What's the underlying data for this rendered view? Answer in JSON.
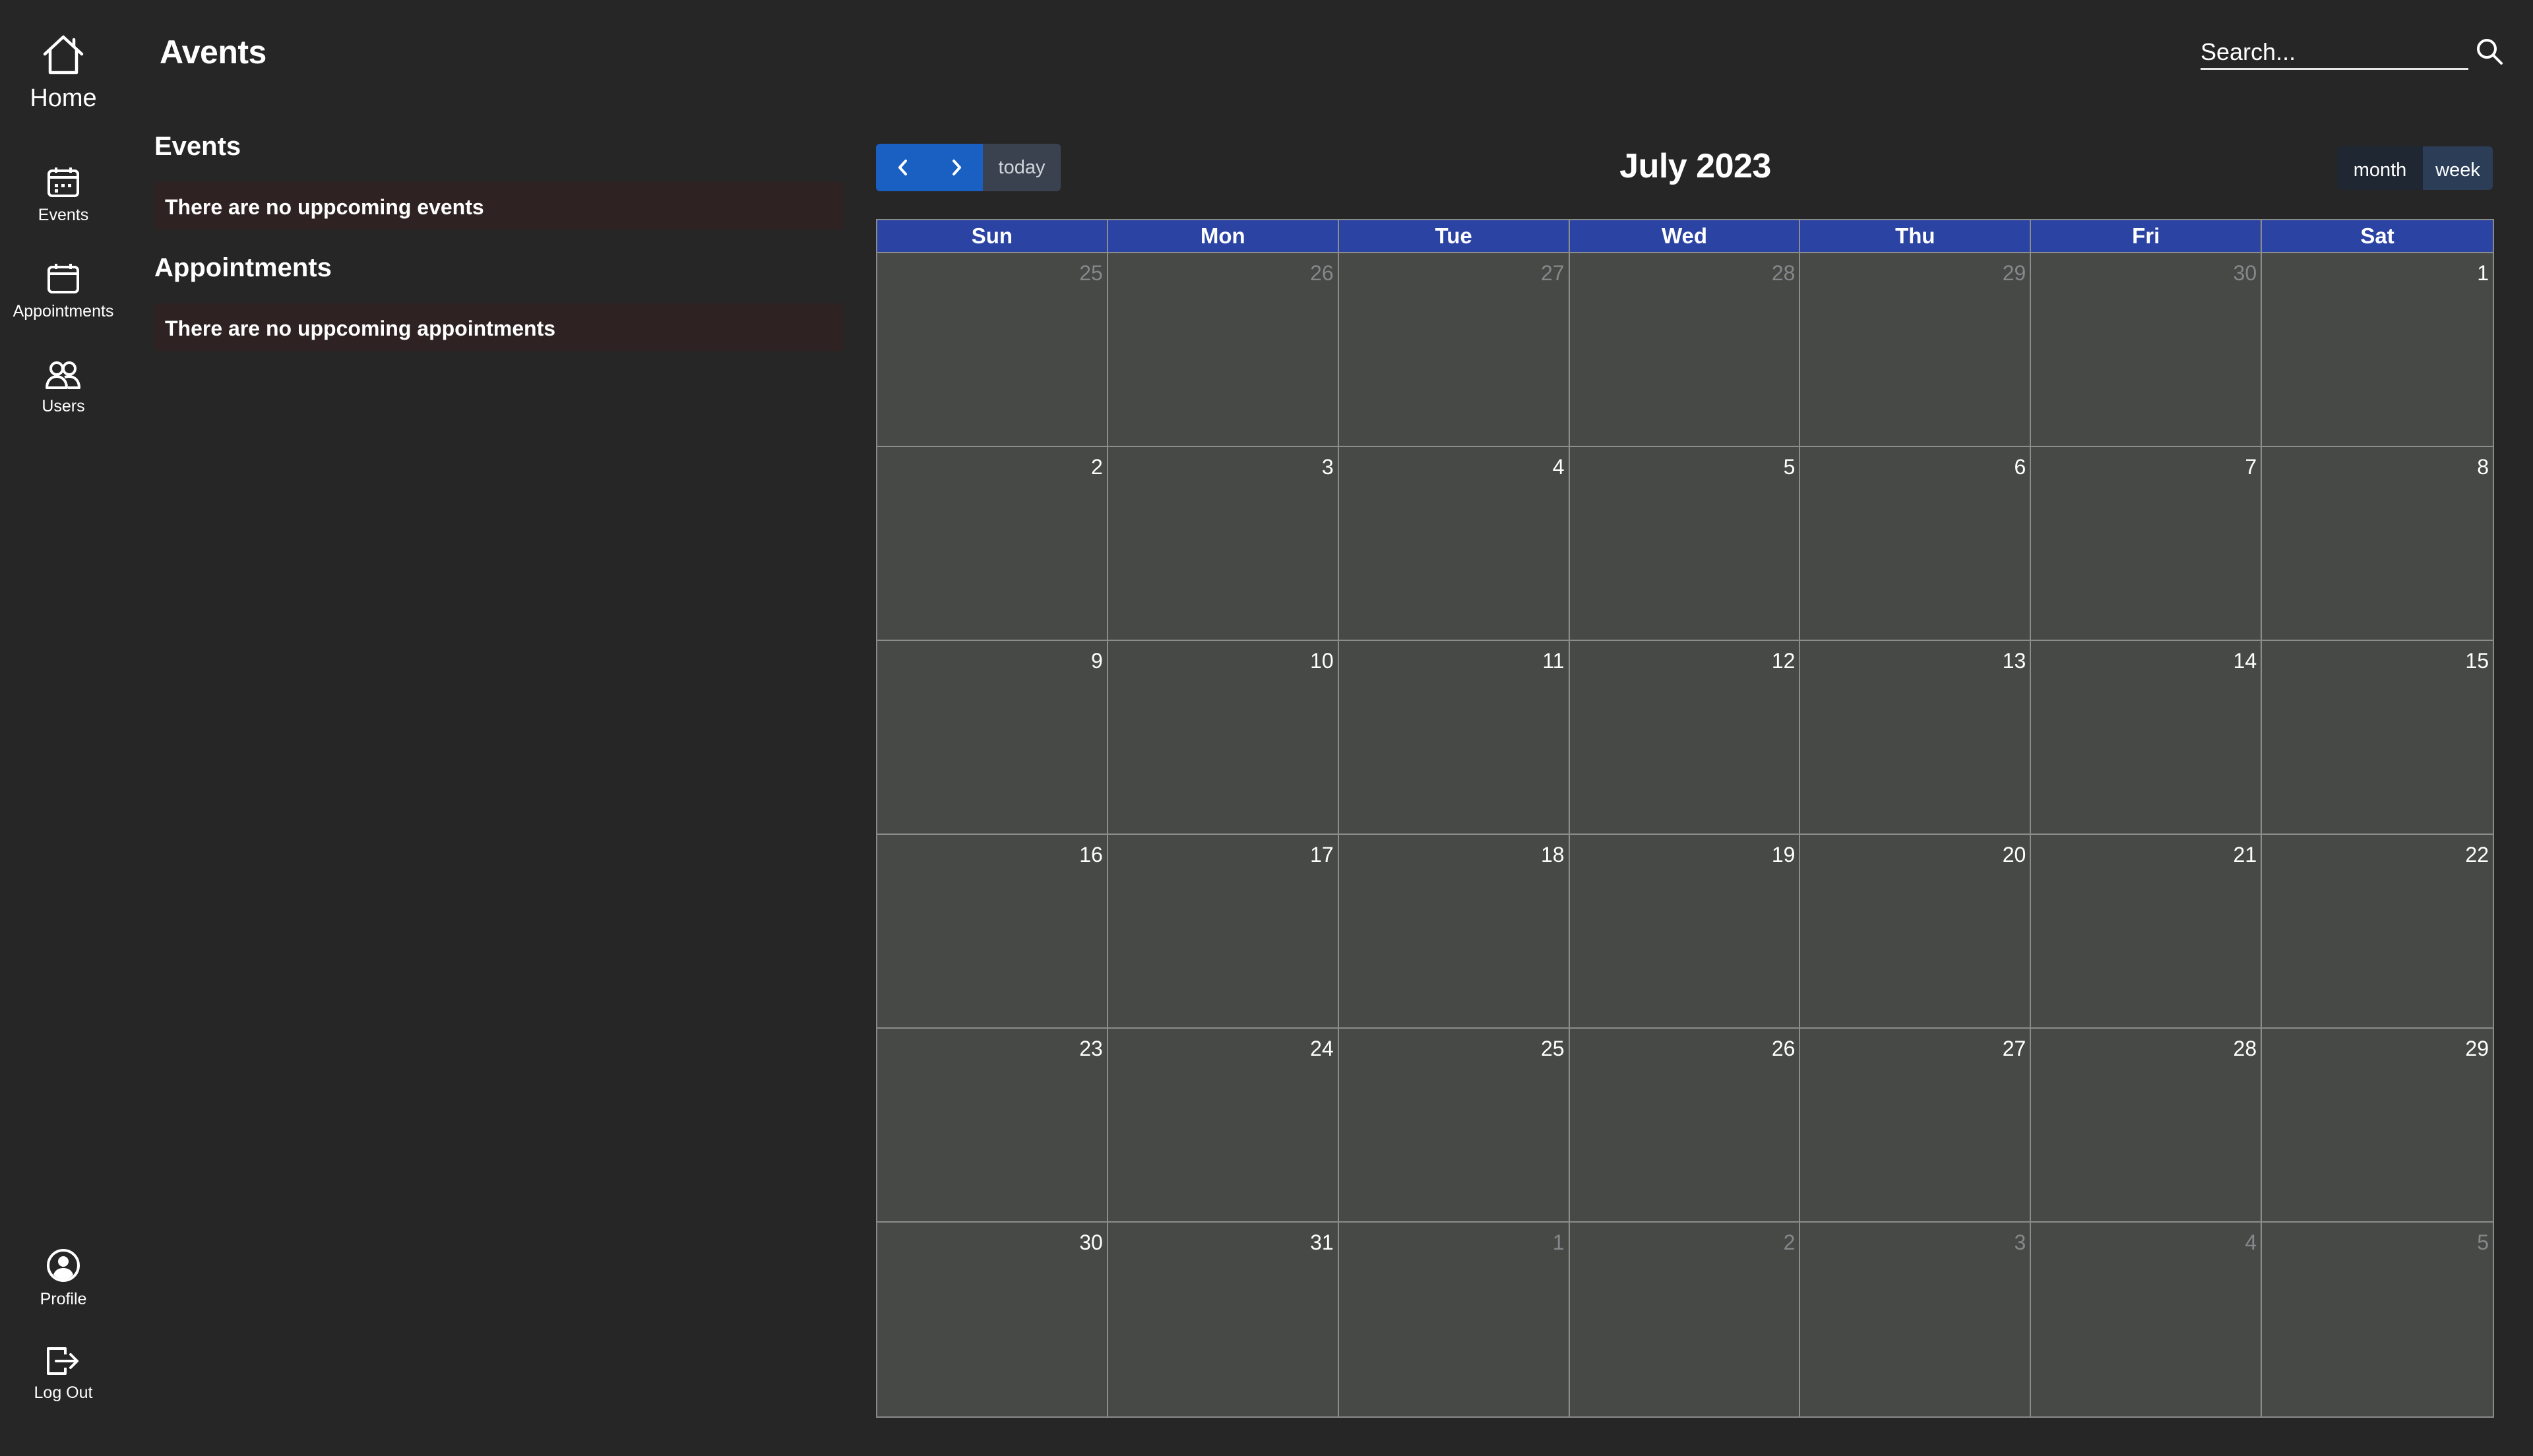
{
  "app": {
    "title": "Avents"
  },
  "search": {
    "placeholder": "Search..."
  },
  "nav": {
    "home": "Home",
    "events": "Events",
    "appointments": "Appointments",
    "users": "Users",
    "profile": "Profile",
    "logout": "Log Out"
  },
  "panels": {
    "events_heading": "Events",
    "events_empty": "There are no uppcoming events",
    "appointments_heading": "Appointments",
    "appointments_empty": "There are no uppcoming appointments"
  },
  "calendar": {
    "title": "July 2023",
    "today_label": "today",
    "month_label": "month",
    "week_label": "week",
    "weekdays": [
      "Sun",
      "Mon",
      "Tue",
      "Wed",
      "Thu",
      "Fri",
      "Sat"
    ],
    "weeks": [
      [
        {
          "d": "25",
          "o": true
        },
        {
          "d": "26",
          "o": true
        },
        {
          "d": "27",
          "o": true
        },
        {
          "d": "28",
          "o": true
        },
        {
          "d": "29",
          "o": true
        },
        {
          "d": "30",
          "o": true
        },
        {
          "d": "1",
          "o": false
        }
      ],
      [
        {
          "d": "2",
          "o": false
        },
        {
          "d": "3",
          "o": false
        },
        {
          "d": "4",
          "o": false
        },
        {
          "d": "5",
          "o": false
        },
        {
          "d": "6",
          "o": false
        },
        {
          "d": "7",
          "o": false
        },
        {
          "d": "8",
          "o": false
        }
      ],
      [
        {
          "d": "9",
          "o": false
        },
        {
          "d": "10",
          "o": false
        },
        {
          "d": "11",
          "o": false
        },
        {
          "d": "12",
          "o": false
        },
        {
          "d": "13",
          "o": false
        },
        {
          "d": "14",
          "o": false
        },
        {
          "d": "15",
          "o": false
        }
      ],
      [
        {
          "d": "16",
          "o": false
        },
        {
          "d": "17",
          "o": false
        },
        {
          "d": "18",
          "o": false
        },
        {
          "d": "19",
          "o": false
        },
        {
          "d": "20",
          "o": false
        },
        {
          "d": "21",
          "o": false
        },
        {
          "d": "22",
          "o": false
        }
      ],
      [
        {
          "d": "23",
          "o": false
        },
        {
          "d": "24",
          "o": false
        },
        {
          "d": "25",
          "o": false
        },
        {
          "d": "26",
          "o": false
        },
        {
          "d": "27",
          "o": false
        },
        {
          "d": "28",
          "o": false
        },
        {
          "d": "29",
          "o": false
        }
      ],
      [
        {
          "d": "30",
          "o": false
        },
        {
          "d": "31",
          "o": false
        },
        {
          "d": "1",
          "o": true
        },
        {
          "d": "2",
          "o": true
        },
        {
          "d": "3",
          "o": true
        },
        {
          "d": "4",
          "o": true
        },
        {
          "d": "5",
          "o": true
        }
      ]
    ]
  },
  "icons": {
    "home": "home-icon",
    "events": "calendar-events-icon",
    "appointments": "calendar-icon",
    "users": "users-icon",
    "profile": "profile-icon",
    "logout": "logout-icon",
    "search": "search-icon",
    "prev": "chevron-left-icon",
    "next": "chevron-right-icon"
  },
  "colors": {
    "background": "#272627",
    "header_row": "#2b43a3",
    "day_cell": "#474947",
    "primary_button": "#1a5fc2",
    "empty_box": "#2f2222"
  }
}
